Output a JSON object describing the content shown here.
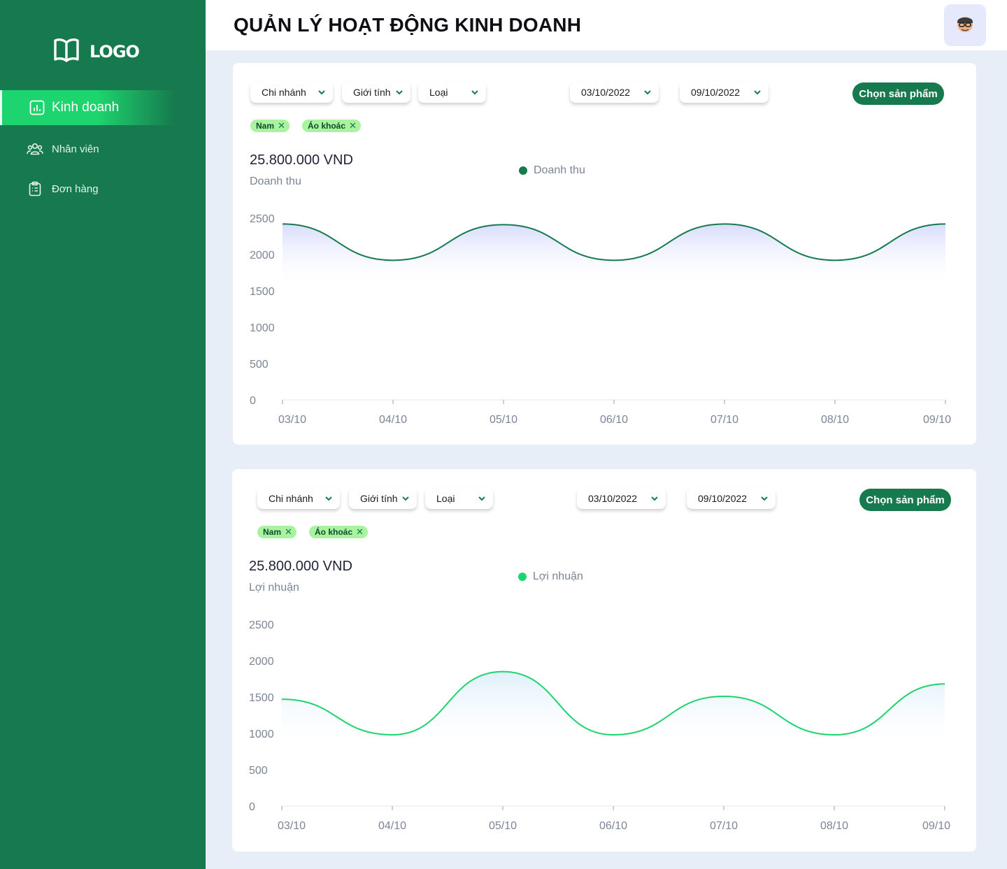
{
  "sidebar": {
    "logo": "LOGO",
    "items": [
      {
        "label": "Kinh doanh",
        "icon": "bar-chart-icon",
        "active": true
      },
      {
        "label": "Nhân viên",
        "icon": "users-icon",
        "active": false
      },
      {
        "label": "Đơn hàng",
        "icon": "clipboard-icon",
        "active": false
      }
    ]
  },
  "header": {
    "title": "QUẢN LÝ HOẠT ĐỘNG KINH DOANH",
    "avatar_icon": "user-avatar-icon"
  },
  "panels": [
    {
      "filters": {
        "branch": "Chi nhánh",
        "gender": "Giới tính",
        "type": "Loại",
        "date_from": "03/10/2022",
        "date_to": "09/10/2022"
      },
      "select_product": "Chọn sản phẩm",
      "tags": [
        "Nam",
        "Áo khoác"
      ],
      "value": "25.800.000 VND",
      "metric": "Doanh thu",
      "legend": "Doanh thu",
      "color": "#167a4e"
    },
    {
      "filters": {
        "branch": "Chi nhánh",
        "gender": "Giới tính",
        "type": "Loại",
        "date_from": "03/10/2022",
        "date_to": "09/10/2022"
      },
      "select_product": "Chọn sản phẩm",
      "tags": [
        "Nam",
        "Áo khoác"
      ],
      "value": "25.800.000 VND",
      "metric": "Lợi nhuận",
      "legend": "Lợi nhuận",
      "color": "#1ed46e"
    }
  ],
  "chart_data": [
    {
      "type": "area",
      "x": [
        "03/10",
        "04/10",
        "05/10",
        "06/10",
        "07/10",
        "08/10",
        "09/10"
      ],
      "yticks": [
        "2500",
        "2000",
        "1500",
        "1000",
        "500",
        "0"
      ],
      "ylim": [
        0,
        2500
      ],
      "series": [
        {
          "name": "Doanh thu",
          "values": [
            2420,
            1920,
            2410,
            1920,
            2420,
            1920,
            2420
          ],
          "color": "#167a4e"
        }
      ]
    },
    {
      "type": "area",
      "x": [
        "03/10",
        "04/10",
        "05/10",
        "06/10",
        "07/10",
        "08/10",
        "09/10"
      ],
      "yticks": [
        "2500",
        "2000",
        "1500",
        "1000",
        "500",
        "0"
      ],
      "ylim": [
        0,
        2500
      ],
      "series": [
        {
          "name": "Lợi nhuận",
          "values": [
            1470,
            980,
            1850,
            980,
            1510,
            980,
            1680
          ],
          "color": "#1ed46e"
        }
      ]
    }
  ]
}
